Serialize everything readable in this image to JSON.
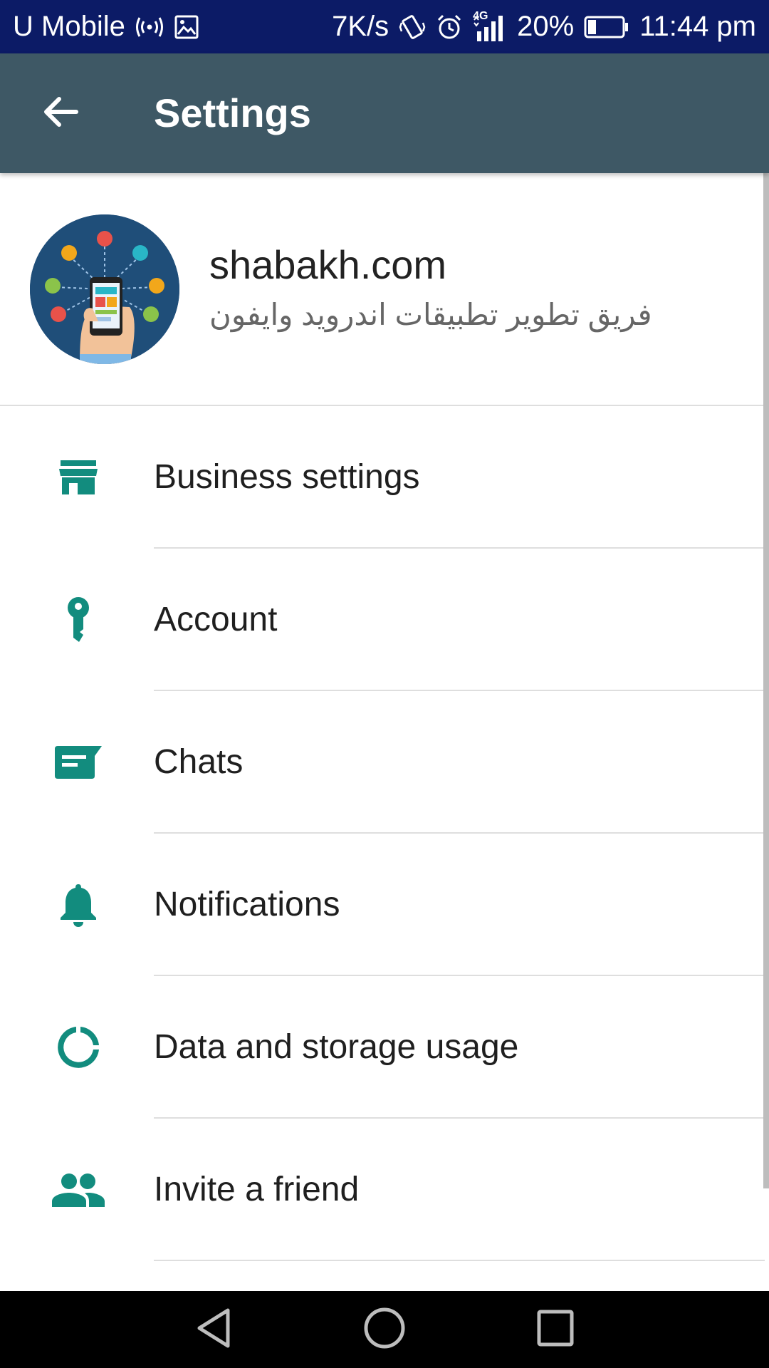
{
  "status_bar": {
    "carrier": "U Mobile",
    "speed": "7K/s",
    "network_type": "4G",
    "battery": "20%",
    "time": "11:44 pm",
    "icons": [
      "hotspot-icon",
      "image-icon",
      "vibrate-icon",
      "alarm-icon",
      "signal-icon",
      "battery-icon"
    ]
  },
  "app_bar": {
    "title": "Settings",
    "back_icon": "arrow-back-icon"
  },
  "profile": {
    "name": "shabakh.com",
    "status": "فريق تطوير تطبيقات اندرويد وايفون"
  },
  "settings": {
    "items": [
      {
        "label": "Business settings",
        "icon": "store-icon"
      },
      {
        "label": "Account",
        "icon": "key-icon"
      },
      {
        "label": "Chats",
        "icon": "chat-icon"
      },
      {
        "label": "Notifications",
        "icon": "bell-icon"
      },
      {
        "label": "Data and storage usage",
        "icon": "data-usage-icon"
      },
      {
        "label": "Invite a friend",
        "icon": "people-icon"
      }
    ]
  },
  "nav_bar": {
    "buttons": [
      "back-triangle-icon",
      "home-circle-icon",
      "recents-square-icon"
    ]
  },
  "colors": {
    "status_bar": "#0c1b66",
    "app_bar": "#3e5865",
    "accent": "#128c7e",
    "nav_bar": "#000000"
  }
}
